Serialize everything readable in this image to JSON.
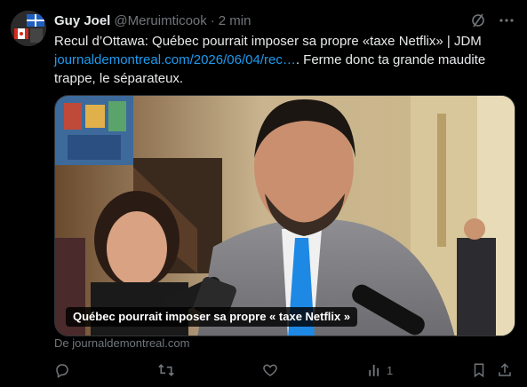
{
  "tweet": {
    "author_name": "Guy Joel",
    "handle": "@Meruimticook",
    "separator": "·",
    "time": "2 min",
    "text_before_link": "Recul d’Ottawa: Québec pourrait imposer sa propre «taxe Netflix» | JDM ",
    "link_text": "journaldemontreal.com/2026/06/04/rec…",
    "text_after_link": ". Ferme donc ta grande maudite trappe, le séparateux."
  },
  "media": {
    "caption": "Québec pourrait imposer sa propre « taxe Netflix »",
    "source": "De journaldemontreal.com"
  },
  "actions": {
    "reply_count": "",
    "retweet_count": "",
    "like_count": "",
    "views_count": "1"
  },
  "colors": {
    "background": "#000000",
    "text": "#e7e9ea",
    "muted": "#71767b",
    "link": "#1d9bf0",
    "tie": "#1e88e5"
  },
  "icons": [
    "grok-slash-icon",
    "more-options-icon",
    "reply-icon",
    "retweet-icon",
    "like-icon",
    "views-icon",
    "bookmark-icon",
    "share-icon"
  ]
}
